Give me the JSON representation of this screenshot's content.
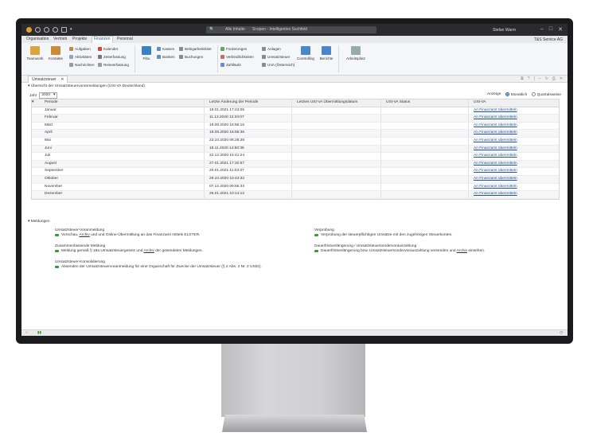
{
  "titlebar": {
    "context": "Alle Inhalte",
    "search_placeholder": "Scopen - Intelligentes Suchfeld",
    "user": "Stefan Warm"
  },
  "menubar": {
    "tabs": [
      "Organisation",
      "Vertrieb",
      "Projekte",
      "Finanzen",
      "Personal"
    ],
    "active": "Finanzen",
    "company": "T&S Service AG"
  },
  "ribbon": {
    "teamwork": "Teamwork",
    "kontakte": "Kontakte",
    "aufgaben": "Aufgaben",
    "aktivitaeten": "Aktivitäten",
    "nachrichten": "Nachrichten",
    "kalender": "Kalender",
    "zeiterfassung": "Zeiterfassung",
    "reiseerfassung": "Reiseerfassung",
    "fibu": "Fibu",
    "kassen": "Kassen",
    "banken": "Banken",
    "belegarbeitsliste": "Belegarbeitsliste",
    "buchungen": "Buchungen",
    "forderungen": "Forderungen",
    "verbindlichkeiten": "Verbindlichkeiten",
    "zahllaeufe": "Zahlläufe",
    "anlagen": "Anlagen",
    "umsatzsteuer": "Umsatzsteuer",
    "uva_at": "UVA (Österreich)",
    "controlling": "Controlling",
    "berichte": "Berichte",
    "arbeitsplatz": "Arbeitsplatz"
  },
  "doc_tab": "Umsatzsteuer",
  "overview": {
    "title": "Übersicht der Umsatzsteuervoranmeldungen (USt-VA Deutschland)",
    "year_label": "Jahr",
    "year_value": "2020",
    "view_label": "Anzeige",
    "view_monthly": "Monatlich",
    "view_quarterly": "Quartalsweise",
    "columns": [
      "Periode",
      "Letzte Änderung der Periode",
      "Letztes USt-VA Übermittlungsdatum",
      "USt-VA Status",
      "USt-VA"
    ],
    "rows": [
      {
        "period": "Januar",
        "changed": "19.01.2021 17:43:05",
        "action": "An Finanzamt übermitteln"
      },
      {
        "period": "Februar",
        "changed": "11.12.2020 12:34:07",
        "action": "An Finanzamt übermitteln"
      },
      {
        "period": "März",
        "changed": "18.08.2020 16:55:16",
        "action": "An Finanzamt übermitteln"
      },
      {
        "period": "April",
        "changed": "18.08.2020 16:55:36",
        "action": "An Finanzamt übermitteln"
      },
      {
        "period": "Mai",
        "changed": "23.10.2020 06:28:38",
        "action": "An Finanzamt übermitteln"
      },
      {
        "period": "Juni",
        "changed": "18.11.2020 14:50:36",
        "action": "An Finanzamt übermitteln"
      },
      {
        "period": "Juli",
        "changed": "22.12.2020 15:41:24",
        "action": "An Finanzamt übermitteln"
      },
      {
        "period": "August",
        "changed": "27.01.2021 17:32:57",
        "action": "An Finanzamt übermitteln"
      },
      {
        "period": "September",
        "changed": "20.01.2021 11:03:37",
        "action": "An Finanzamt übermitteln"
      },
      {
        "period": "Oktober",
        "changed": "29.10.2020 10:43:32",
        "action": "An Finanzamt übermitteln"
      },
      {
        "period": "November",
        "changed": "07.12.2020 09:55:33",
        "action": "An Finanzamt übermitteln"
      },
      {
        "period": "Dezember",
        "changed": "26.01.2021 10:14:12",
        "action": "An Finanzamt übermitteln"
      }
    ]
  },
  "messages": {
    "title": "Meldungen",
    "items": [
      {
        "title": "Umsatzsteuer-Voranmeldung",
        "desc_pre": "Vorschau, ",
        "desc_link": "Archiv",
        "desc_post": " und und Online-Übermittlung an das Finanzamt mittels ELSTER."
      },
      {
        "title": "Verprobung",
        "desc_pre": "Verprobung der steuerpflichtigen Umsätze mit den zugehörigen Steuerkonten.",
        "desc_link": "",
        "desc_post": ""
      },
      {
        "title": "Zusammenfassende Meldung",
        "desc_pre": "Meldung gemäß § 18a Umsatzsteuergesetz und ",
        "desc_link": "Archiv",
        "desc_post": " der gesendeten Meldungen."
      },
      {
        "title": "Dauerfristverlängerung / Umsatzsteuersondervorauszahlung",
        "desc_pre": "Dauerfristverlängerung bzw. Umsatzsteuersondervorauszahlung versenden und ",
        "desc_link": "Archiv",
        "desc_post": " einsehen."
      },
      {
        "title": "Umsatzsteuer-Konsolidierung",
        "desc_pre": "Absenden der Umsatzsteuervoranmeldung für eine Organschaft für Zwecke der Umsatzsteuer (§ 2 Abs. 2 Nr. 2 UStG).",
        "desc_link": "",
        "desc_post": ""
      }
    ]
  },
  "colors": {
    "accent": "#1e5fa8",
    "link": "#1e4f9a",
    "titlebar": "#2b2b2e",
    "monitor_bezel": "#1b1b1d"
  }
}
